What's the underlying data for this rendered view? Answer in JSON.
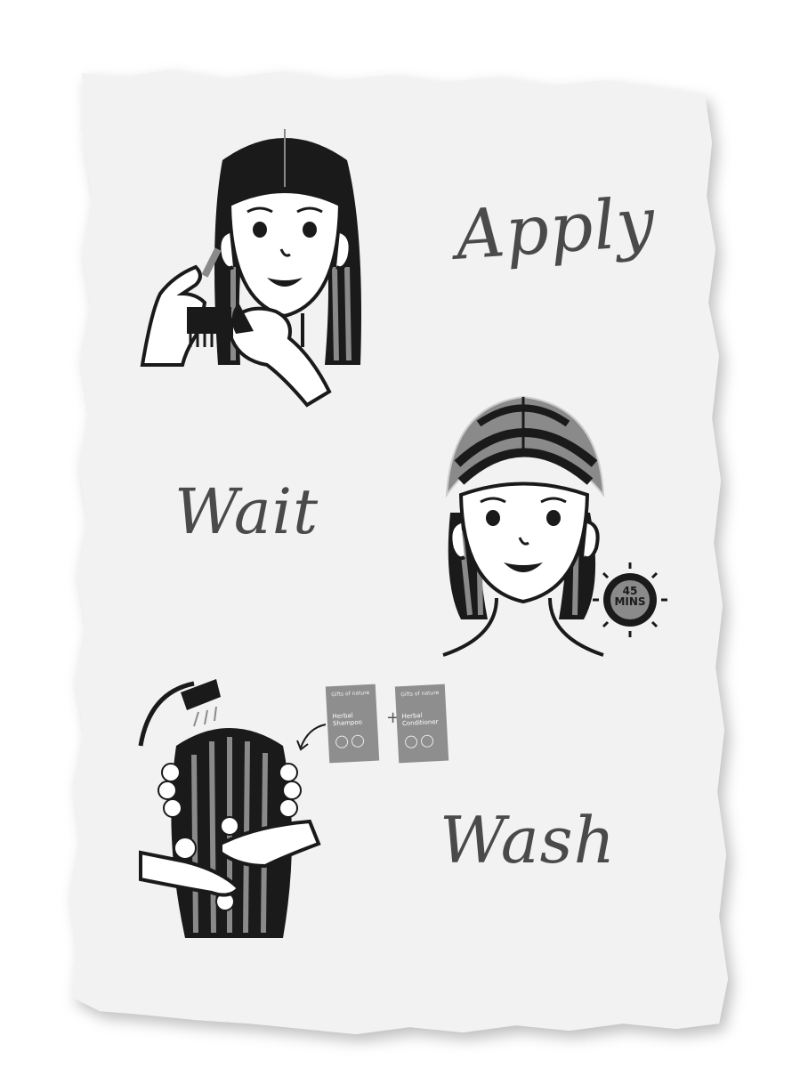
{
  "steps": [
    {
      "word": "Apply"
    },
    {
      "word": "Wait"
    },
    {
      "word": "Wash"
    }
  ],
  "timer": {
    "line1": "45",
    "line2": "MINS"
  },
  "sachets": [
    {
      "brand": "Gifts of nature",
      "name": "Herbal Shampoo"
    },
    {
      "brand": "Gifts of nature",
      "name": "Herbal Conditioner"
    }
  ],
  "plus": "+",
  "colors": {
    "paper": "#f2f2f2",
    "ink": "#1a1a1a",
    "hair_gray": "#8a8a8a",
    "word": "#4a4a4a"
  }
}
